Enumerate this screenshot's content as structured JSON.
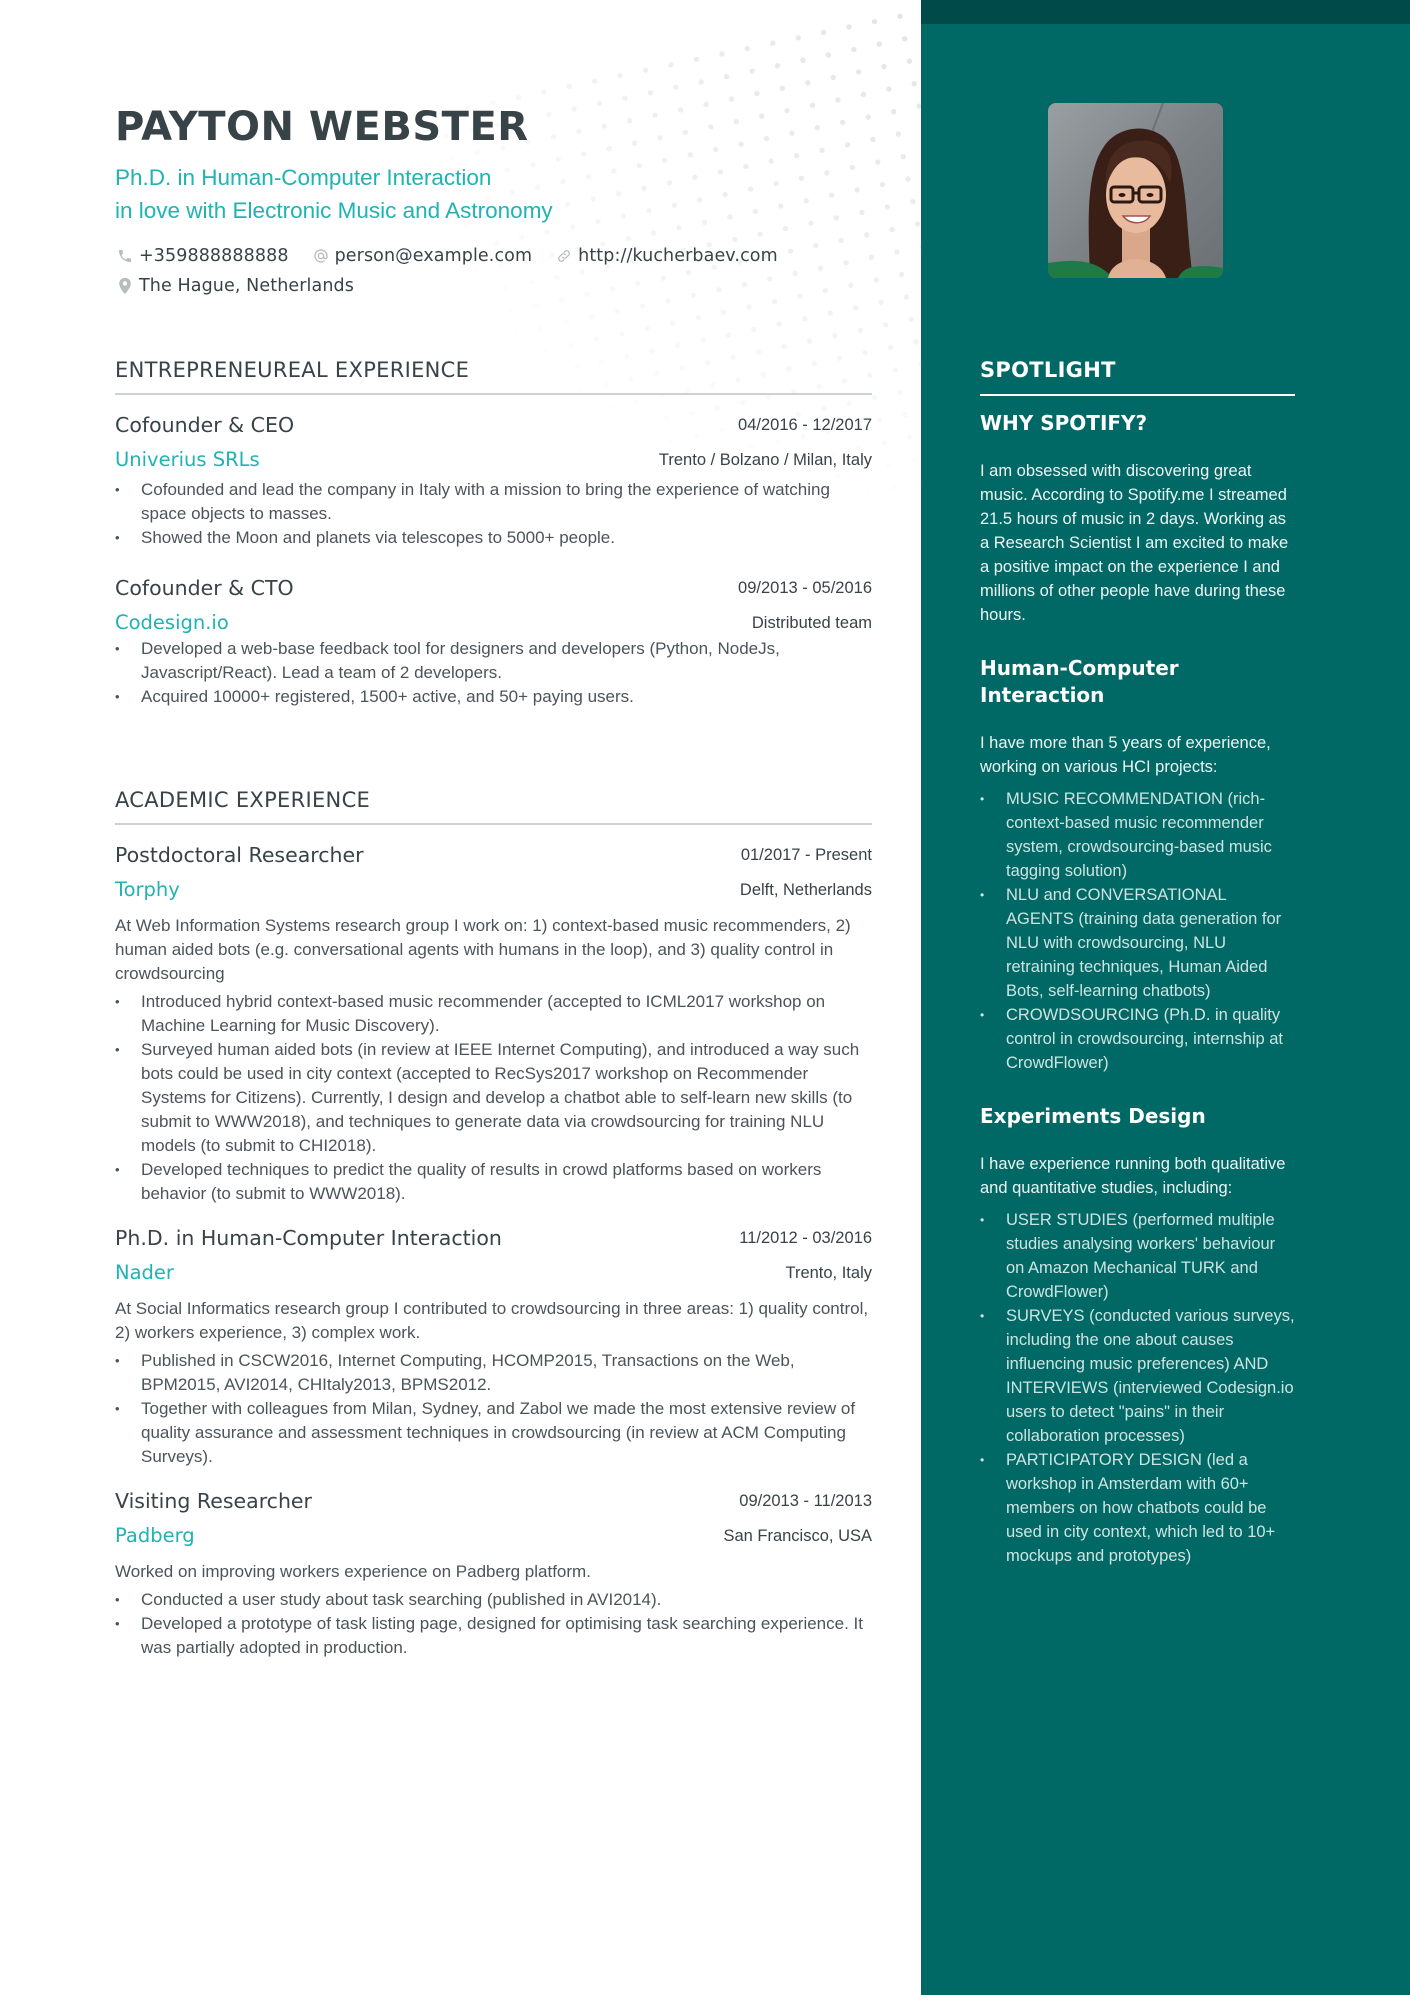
{
  "colors": {
    "accent": "#1fb3b2",
    "text": "#384347",
    "sidebar_bg": "#006966",
    "sidebar_top": "#004b49",
    "divider": "#cdd1d2"
  },
  "header": {
    "name": "PAYTON WEBSTER",
    "headline_line1": "Ph.D. in Human-Computer Interaction",
    "headline_line2": "in love with Electronic Music and Astronomy",
    "contacts": {
      "phone": {
        "icon": "phone-icon",
        "value": "+359888888888"
      },
      "email": {
        "icon": "at-icon",
        "value": "person@example.com"
      },
      "website": {
        "icon": "link-icon",
        "value": "http://kucherbaev.com"
      },
      "location": {
        "icon": "location-pin-icon",
        "value": "The Hague, Netherlands"
      }
    }
  },
  "sections": {
    "entrepreneurial": {
      "title": "ENTREPRENEUREAL EXPERIENCE",
      "jobs": [
        {
          "title": "Cofounder & CEO",
          "date": "04/2016 - 12/2017",
          "company": "Univerius SRLs",
          "location": "Trento / Bolzano / Milan, Italy",
          "description": "",
          "bullets": [
            "Cofounded and lead the company in Italy with a mission to bring the experience of watching space objects to masses.",
            "Showed the Moon and planets via telescopes to 5000+ people."
          ]
        },
        {
          "title": "Cofounder & CTO",
          "date": "09/2013 - 05/2016",
          "company": "Codesign.io",
          "location": "Distributed team",
          "description": "",
          "bullets": [
            "Developed a web-base feedback tool for designers and developers (Python, NodeJs, Javascript/React). Lead a team of 2 developers.",
            "Acquired 10000+ registered, 1500+ active, and 50+ paying users."
          ]
        }
      ]
    },
    "academic": {
      "title": "ACADEMIC EXPERIENCE",
      "jobs": [
        {
          "title": "Postdoctoral Researcher",
          "date": "01/2017 - Present",
          "company": "Torphy",
          "location": "Delft, Netherlands",
          "description": "At Web Information Systems research group I work on: 1) context-based music recommenders, 2) human aided bots (e.g. conversational agents with humans in the loop), and 3) quality control in crowdsourcing",
          "bullets": [
            "Introduced hybrid context-based music recommender (accepted to ICML2017 workshop on Machine Learning for Music Discovery).",
            "Surveyed human aided bots (in review at IEEE Internet Computing), and introduced a way such bots could be used in city context (accepted to RecSys2017 workshop on Recommender Systems for Citizens). Currently, I design and develop a chatbot able to self-learn new skills (to submit to WWW2018), and techniques to generate data via crowdsourcing for training NLU models (to submit to CHI2018).",
            "Developed techniques to predict the quality of results in crowd platforms based on workers behavior (to submit to WWW2018)."
          ]
        },
        {
          "title": "Ph.D. in Human-Computer Interaction",
          "date": "11/2012 - 03/2016",
          "company": "Nader",
          "location": "Trento, Italy",
          "description": "At Social Informatics research group I contributed to crowdsourcing in three areas: 1) quality control, 2) workers experience, 3) complex work.",
          "bullets": [
            "Published in CSCW2016, Internet Computing, HCOMP2015, Transactions on the Web, BPM2015, AVI2014, CHItaly2013, BPMS2012.",
            "Together with colleagues from Milan, Sydney, and Zabol we made  the most extensive review of quality assurance and assessment techniques in crowdsourcing (in review at ACM Computing Surveys)."
          ]
        },
        {
          "title": "Visiting Researcher",
          "date": "09/2013 - 11/2013",
          "company": "Padberg",
          "location": "San Francisco, USA",
          "description": "Worked on improving workers experience on Padberg platform.",
          "bullets": [
            "Conducted a user study about task searching (published in AVI2014).",
            "Developed a prototype of task listing page, designed for optimising task searching experience. It was partially adopted in production."
          ]
        }
      ]
    }
  },
  "sidebar": {
    "photo_alt": "Portrait photo of Payton Webster",
    "title": "SPOTLIGHT",
    "blocks": [
      {
        "heading": "WHY SPOTIFY?",
        "text": "I am obsessed with discovering great music. According to Spotify.me I streamed 21.5 hours of music in 2 days. Working as a Research Scientist I am excited to make a positive impact on the experience I and millions of other people have during these hours.",
        "bullets": []
      },
      {
        "heading": "Human-Computer Interaction",
        "text": "I have more than 5 years of experience, working on various HCI projects:",
        "bullets": [
          "MUSIC RECOMMENDATION (rich-context-based music recommender system, crowdsourcing-based music tagging solution)",
          "NLU and CONVERSATIONAL AGENTS (training data generation for NLU with crowdsourcing, NLU retraining techniques, Human Aided Bots, self-learning chatbots)",
          "CROWDSOURCING (Ph.D. in quality control in crowdsourcing, internship at CrowdFlower)"
        ]
      },
      {
        "heading": "Experiments Design",
        "text": "I have experience running both qualitative and quantitative studies, including:",
        "bullets": [
          "USER STUDIES (performed multiple studies analysing workers' behaviour on Amazon Mechanical TURK and CrowdFlower)",
          "SURVEYS (conducted various surveys, including the one about causes influencing music preferences) AND INTERVIEWS (interviewed Codesign.io users to detect \"pains\" in their collaboration processes)",
          "PARTICIPATORY DESIGN (led a workshop in Amsterdam with 60+ members on how chatbots could be used in city context, which led to 10+ mockups and prototypes)"
        ]
      }
    ]
  }
}
